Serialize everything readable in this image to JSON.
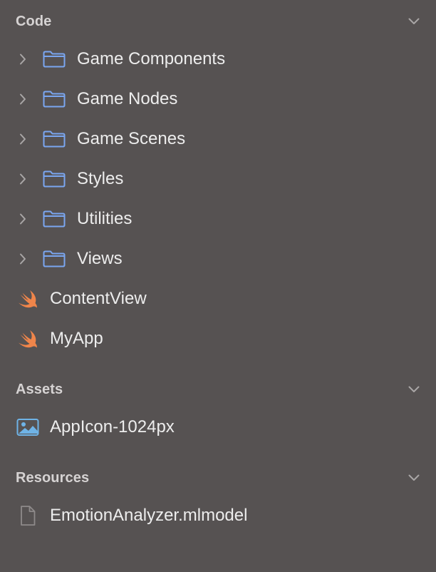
{
  "sections": {
    "code": {
      "title": "Code",
      "folders": [
        {
          "label": "Game Components"
        },
        {
          "label": "Game Nodes"
        },
        {
          "label": "Game Scenes"
        },
        {
          "label": "Styles"
        },
        {
          "label": "Utilities"
        },
        {
          "label": "Views"
        }
      ],
      "files": [
        {
          "label": "ContentView",
          "icon": "swift-file-icon"
        },
        {
          "label": "MyApp",
          "icon": "swift-file-icon"
        }
      ]
    },
    "assets": {
      "title": "Assets",
      "files": [
        {
          "label": "AppIcon-1024px",
          "icon": "image-file-icon"
        }
      ]
    },
    "resources": {
      "title": "Resources",
      "files": [
        {
          "label": "EmotionAnalyzer.mlmodel",
          "icon": "document-file-icon"
        }
      ]
    }
  },
  "colors": {
    "background": "#565252",
    "folder_icon": "#7aa6f0",
    "swift_icon": "#f0854a",
    "image_icon": "#6fb3e6",
    "text": "#ededed",
    "header_text": "#d6d3d3",
    "chevron": "#a9a6a6"
  }
}
